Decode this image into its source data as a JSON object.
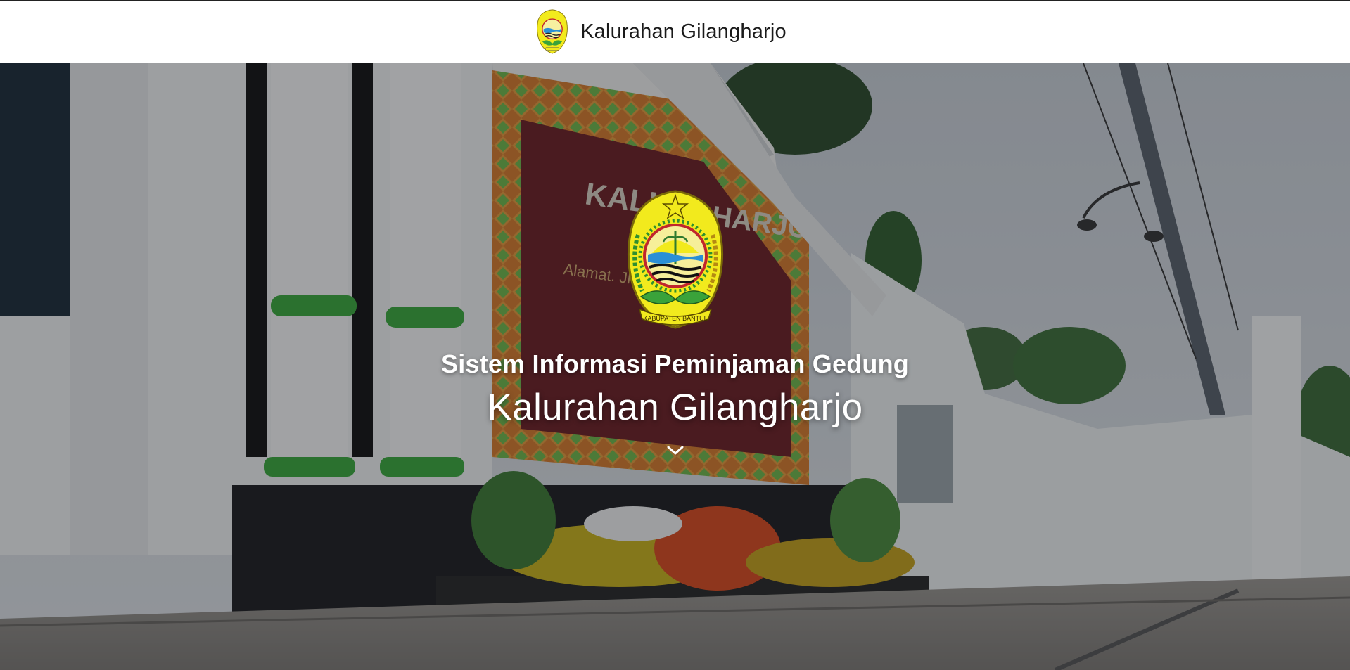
{
  "navbar": {
    "brand_text": "Kalurahan Gilangharjo",
    "logo_icon": "kabupaten-bantul-emblem-icon"
  },
  "hero": {
    "emblem_icon": "kabupaten-bantul-emblem-icon",
    "emblem_ribbon_text": "KABUPATEN BANTUL",
    "subtitle": "Sistem Informasi Peminjaman Gedung",
    "title": "Kalurahan Gilangharjo",
    "scroll_icon": "chevron-down-icon",
    "background_image": "kalurahan-office-building-photo",
    "overlay_opacity": 0.38
  },
  "colors": {
    "navbar_bg": "#ffffff",
    "brand_text": "#1a1a1a",
    "hero_text": "#ffffff",
    "emblem_yellow": "#f2ea1d",
    "emblem_green": "#3aa33a",
    "emblem_red": "#c0262d"
  }
}
